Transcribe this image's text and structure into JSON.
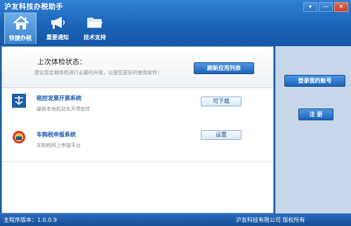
{
  "app": {
    "title": "沪友科技办税助手"
  },
  "window_controls": {
    "menu": "▾",
    "minimize": "—",
    "close": "✕"
  },
  "tabs": [
    {
      "label": "快捷办税",
      "icon": "home-icon",
      "active": true
    },
    {
      "label": "重要通知",
      "icon": "megaphone-icon",
      "active": false
    },
    {
      "label": "技术支持",
      "icon": "folder-icon",
      "active": false
    }
  ],
  "check": {
    "title": "上次体检状态：",
    "description": "建议您定期体检进行必要的升级，以便您更好的使用软件！",
    "refresh_label": "刷新应用列表"
  },
  "apps": [
    {
      "name": "税控发票开票系统",
      "description": "最新本地机动车开票软件",
      "action": "可下载",
      "icon": "tax-logo-icon"
    },
    {
      "name": "车购税申报系统",
      "description": "车购税网上申报平台",
      "action": "设置",
      "icon": "emblem-icon"
    }
  ],
  "side": {
    "login_label": "登录我的账号",
    "register_label": "注 册"
  },
  "status": {
    "version": "主程序版本：1.0.0.9",
    "copyright": "沪友科技有限公司 版权所有"
  }
}
